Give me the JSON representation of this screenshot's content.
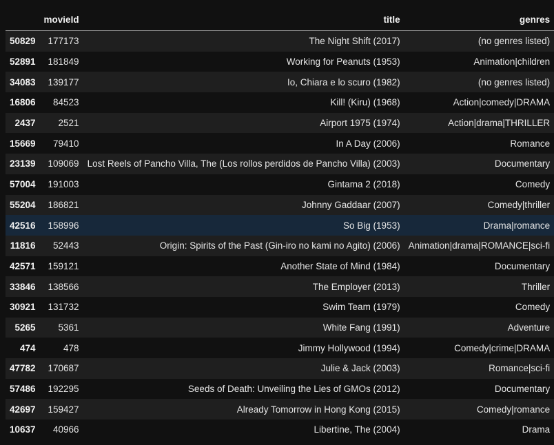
{
  "table": {
    "columns": [
      "",
      "movieId",
      "title",
      "genres"
    ],
    "hovered_index": "42516",
    "rows": [
      {
        "index": "50829",
        "movieId": "177173",
        "title": "The Night Shift (2017)",
        "genres": "(no genres listed)"
      },
      {
        "index": "52891",
        "movieId": "181849",
        "title": "Working for Peanuts (1953)",
        "genres": "Animation|children"
      },
      {
        "index": "34083",
        "movieId": "139177",
        "title": "Io, Chiara e lo scuro (1982)",
        "genres": "(no genres listed)"
      },
      {
        "index": "16806",
        "movieId": "84523",
        "title": "Kill! (Kiru) (1968)",
        "genres": "Action|comedy|DRAMA"
      },
      {
        "index": "2437",
        "movieId": "2521",
        "title": "Airport 1975 (1974)",
        "genres": "Action|drama|THRILLER"
      },
      {
        "index": "15669",
        "movieId": "79410",
        "title": "In A Day (2006)",
        "genres": "Romance"
      },
      {
        "index": "23139",
        "movieId": "109069",
        "title": "Lost Reels of Pancho Villa, The (Los rollos perdidos de Pancho Villa) (2003)",
        "genres": "Documentary"
      },
      {
        "index": "57004",
        "movieId": "191003",
        "title": "Gintama 2 (2018)",
        "genres": "Comedy"
      },
      {
        "index": "55204",
        "movieId": "186821",
        "title": "Johnny Gaddaar (2007)",
        "genres": "Comedy|thriller"
      },
      {
        "index": "42516",
        "movieId": "158996",
        "title": "So Big (1953)",
        "genres": "Drama|romance"
      },
      {
        "index": "11816",
        "movieId": "52443",
        "title": "Origin: Spirits of the Past (Gin-iro no kami no Agito) (2006)",
        "genres": "Animation|drama|ROMANCE|sci-fi"
      },
      {
        "index": "42571",
        "movieId": "159121",
        "title": "Another State of Mind (1984)",
        "genres": "Documentary"
      },
      {
        "index": "33846",
        "movieId": "138566",
        "title": "The Employer (2013)",
        "genres": "Thriller"
      },
      {
        "index": "30921",
        "movieId": "131732",
        "title": "Swim Team (1979)",
        "genres": "Comedy"
      },
      {
        "index": "5265",
        "movieId": "5361",
        "title": "White Fang (1991)",
        "genres": "Adventure"
      },
      {
        "index": "474",
        "movieId": "478",
        "title": "Jimmy Hollywood (1994)",
        "genres": "Comedy|crime|DRAMA"
      },
      {
        "index": "47782",
        "movieId": "170687",
        "title": "Julie & Jack (2003)",
        "genres": "Romance|sci-fi"
      },
      {
        "index": "57486",
        "movieId": "192295",
        "title": "Seeds of Death: Unveiling the Lies of GMOs (2012)",
        "genres": "Documentary"
      },
      {
        "index": "42697",
        "movieId": "159427",
        "title": "Already Tomorrow in Hong Kong (2015)",
        "genres": "Comedy|romance"
      },
      {
        "index": "10637",
        "movieId": "40966",
        "title": "Libertine, The (2004)",
        "genres": "Drama"
      }
    ]
  }
}
